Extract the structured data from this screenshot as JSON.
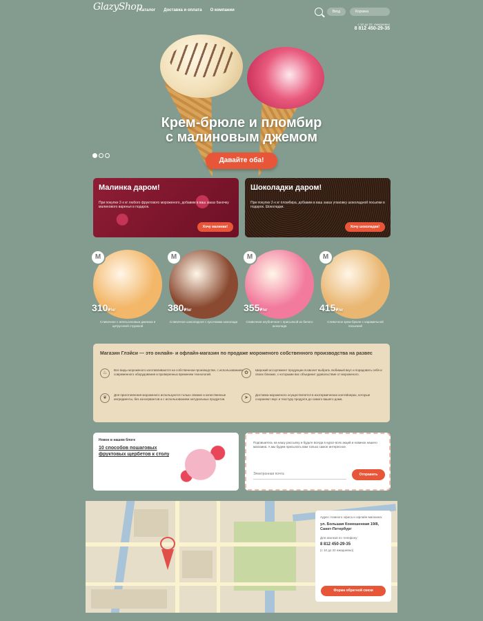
{
  "header": {
    "logo_text": "GlazyShop",
    "nav": [
      "Каталог",
      "Доставка и оплата",
      "О компании"
    ],
    "login_label": "Вход",
    "cart_label": "Корзина",
    "phone_sub": "с 10 до 22, ежедневно",
    "phone": "8 812 450-29-35"
  },
  "hero": {
    "title_line1": "Крем-брюле и пломбир",
    "title_line2": "с малиновым джемом",
    "button": "Давайте оба!",
    "slide_count": 3,
    "active_slide": 1
  },
  "promos": [
    {
      "title": "Малинка даром!",
      "text": "При покупке 2-х кг любого фруктового мороженого, добавим в ваш заказ баночку малинового варенья в подарок.",
      "button": "Хочу малинки!"
    },
    {
      "title": "Шоколадки даром!",
      "text": "При покупке 2-х кг пломбира, добавим в ваш заказ упаковку шоколадной посыпки в подарок. Шоколадки.",
      "button": "Хочу шоколадки!"
    }
  ],
  "products": [
    {
      "badge": "М",
      "price": "310",
      "unit": "₽/кг",
      "desc": "Сливочное с апельсиновым джемом и цитрусовой стружкой",
      "color": "#f3b769"
    },
    {
      "badge": "М",
      "price": "380",
      "unit": "₽/кг",
      "desc": "Сливочное шоколадное с кусочками шоколада",
      "color": "#8a4a32"
    },
    {
      "badge": "М",
      "price": "355",
      "unit": "₽/кг",
      "desc": "Сливочное клубничное с присыпкой из белого шоколада",
      "color": "#f27a9d"
    },
    {
      "badge": "М",
      "price": "415",
      "unit": "₽/кг",
      "desc": "Сливочное крем-брюле с карамельной посыпкой",
      "color": "#e9b772"
    }
  ],
  "about": {
    "title": "Магазин Глэйси — это онлайн- и офлайн-магазин по продаже мороженого собственного производства на развес",
    "features": [
      {
        "icon": "spoon-icon",
        "glyph": "♨",
        "text": "Все виды мороженого изготавливаются на собственном производстве, с использованием современного оборудования и проверенных временем технологий."
      },
      {
        "icon": "gift-icon",
        "glyph": "✿",
        "text": "Широкий ассортимент продукции позволит выбрать любимый вкус и порадовать себя и своих близких, с которыми вас объединит удовольствие от мороженого."
      },
      {
        "icon": "leaf-icon",
        "glyph": "❦",
        "text": "Для приготовления мороженого используются только свежие и качественные ингредиенты, без консервантов и с использованием натуральных продуктов."
      },
      {
        "icon": "truck-icon",
        "glyph": "➤",
        "text": "Доставка мороженого осуществляется в изотермических контейнерах, которые сохраняют вкус и текстуру продукта до самого вашего дома."
      }
    ]
  },
  "blog": {
    "label": "Новое в нашем блоге",
    "title": "10 способов пошаговых фруктовых щербетов к столу"
  },
  "subscribe": {
    "text": "Подпишитесь на нашу рассылку и будьте всегда в курсе всех акций и новинок нашего магазина. А мы будем присылать вам только самое интересное.",
    "placeholder": "Электронная почта",
    "button": "Отправить"
  },
  "map_card": {
    "label1": "Адрес главного офиса и офлайн-магазина:",
    "address": "ул. Большая Конюшенная 19/8, Санкт-Петербург",
    "label2": "Для звонков по телефону:",
    "phone": "8 812 450-29-35",
    "hours": "(с 10 до 22 ежедневно)",
    "button": "Форма обратной связи"
  }
}
